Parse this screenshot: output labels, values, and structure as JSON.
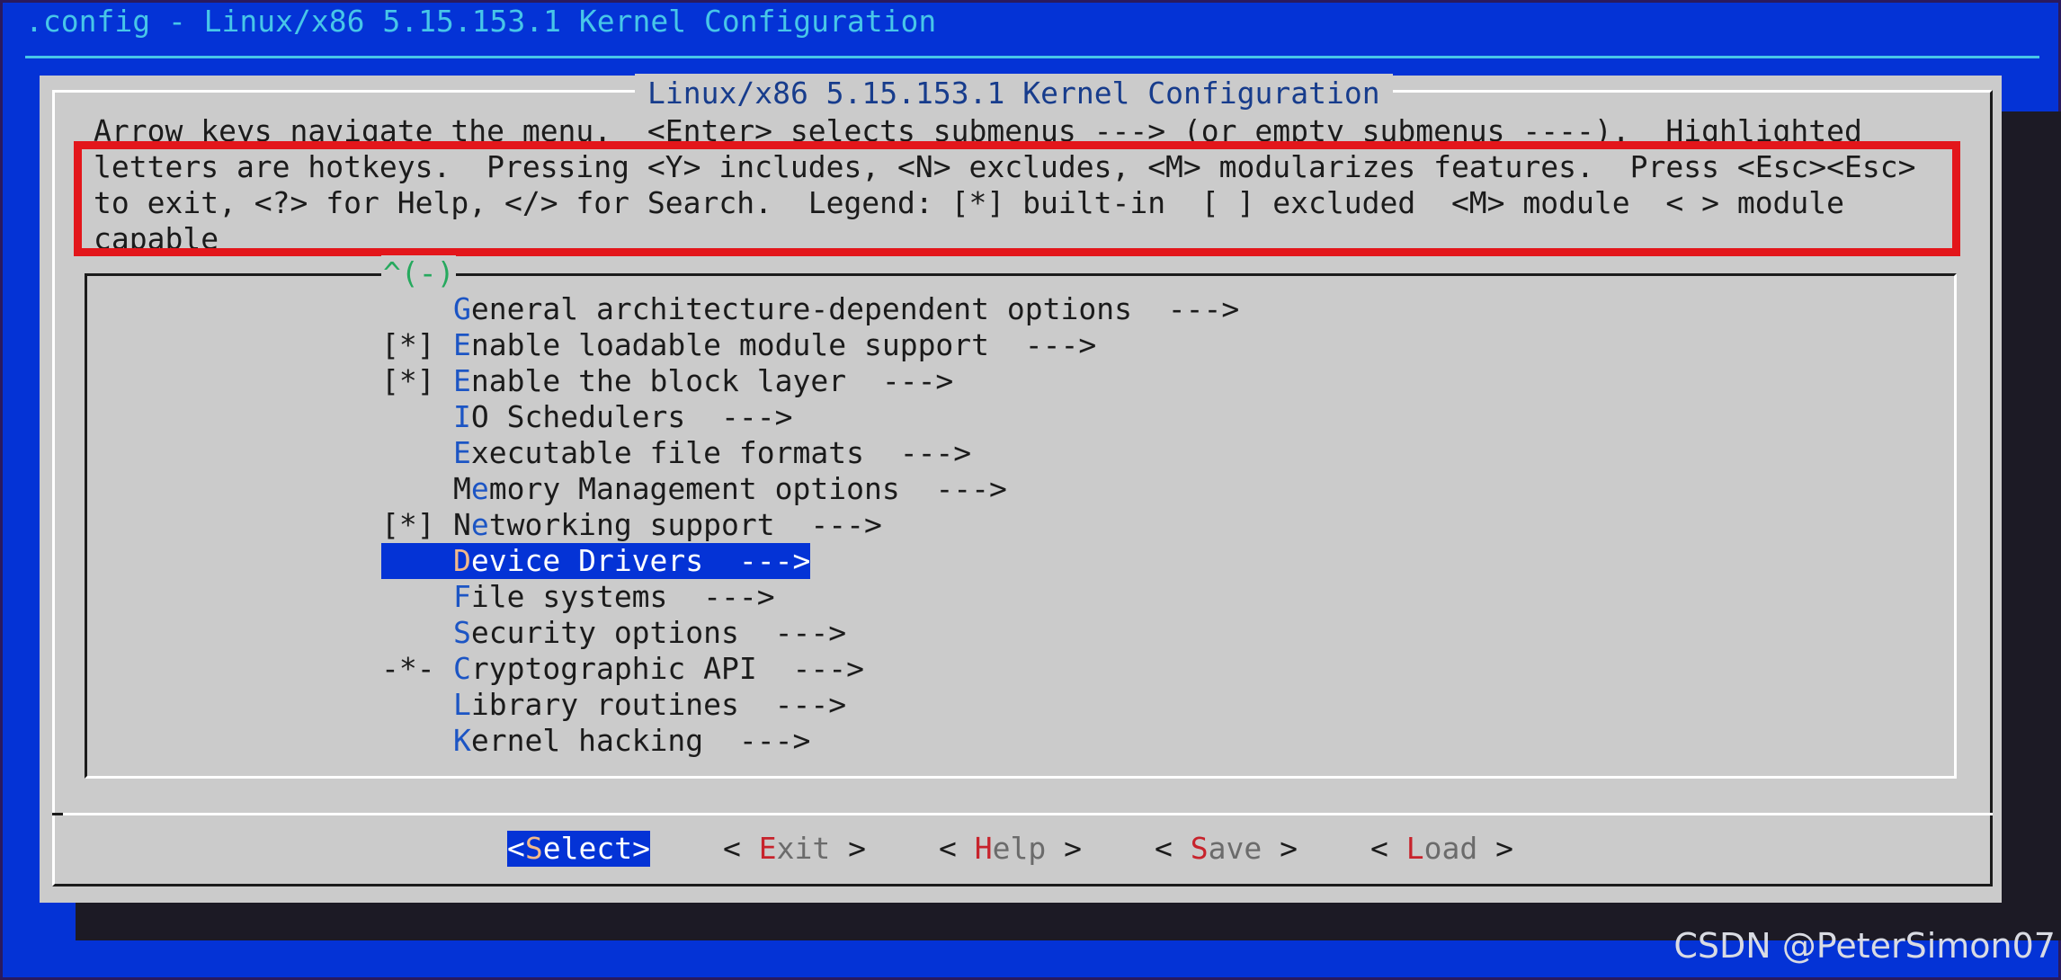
{
  "window": {
    "title": ".config - Linux/x86 5.15.153.1 Kernel Configuration"
  },
  "dialog": {
    "title": "Linux/x86 5.15.153.1 Kernel Configuration",
    "help_lines": [
      "Arrow keys navigate the menu.  <Enter> selects submenus ---> (or empty submenus ----).  Highlighted",
      "letters are hotkeys.  Pressing <Y> includes, <N> excludes, <M> modularizes features.  Press <Esc><Esc>",
      "to exit, <?> for Help, </> for Search.  Legend: [*] built-in  [ ] excluded  <M> module  < > module",
      "capable"
    ]
  },
  "menu": {
    "scroll_indicator": "^(-)",
    "selected_index": 7,
    "items": [
      {
        "prefix": "",
        "hotkey": "G",
        "before": "",
        "after": "eneral architecture-dependent options  --->"
      },
      {
        "prefix": "[*]",
        "hotkey": "E",
        "before": "",
        "after": "nable loadable module support  --->"
      },
      {
        "prefix": "[*]",
        "hotkey": "E",
        "before": "",
        "after": "nable the block layer  --->"
      },
      {
        "prefix": "",
        "hotkey": "I",
        "before": "",
        "after": "O Schedulers  --->"
      },
      {
        "prefix": "",
        "hotkey": "E",
        "before": "",
        "after": "xecutable file formats  --->"
      },
      {
        "prefix": "",
        "hotkey": "e",
        "before": "M",
        "after": "mory Management options  --->"
      },
      {
        "prefix": "[*]",
        "hotkey": "e",
        "before": "N",
        "after": "tworking support  --->"
      },
      {
        "prefix": "",
        "hotkey": "D",
        "before": "",
        "after": "evice Drivers  --->"
      },
      {
        "prefix": "",
        "hotkey": "F",
        "before": "",
        "after": "ile systems  --->"
      },
      {
        "prefix": "",
        "hotkey": "S",
        "before": "",
        "after": "ecurity options  --->"
      },
      {
        "prefix": "-*-",
        "hotkey": "C",
        "before": "",
        "after": "ryptographic API  --->"
      },
      {
        "prefix": "",
        "hotkey": "L",
        "before": "",
        "after": "ibrary routines  --->"
      },
      {
        "prefix": "",
        "hotkey": "K",
        "before": "",
        "after": "ernel hacking  --->"
      }
    ]
  },
  "buttons": [
    {
      "open": "<",
      "hotkey": "S",
      "rest": "elect",
      "close": ">",
      "selected": true
    },
    {
      "open": "< ",
      "hotkey": "E",
      "rest": "xit",
      "close": " >",
      "selected": false
    },
    {
      "open": "< ",
      "hotkey": "H",
      "rest": "elp",
      "close": " >",
      "selected": false
    },
    {
      "open": "< ",
      "hotkey": "S",
      "rest": "ave",
      "close": " >",
      "selected": false
    },
    {
      "open": "< ",
      "hotkey": "L",
      "rest": "oad",
      "close": " >",
      "selected": false
    }
  ],
  "annotation": {
    "color": "#e3161b"
  },
  "watermark": "CSDN @PeterSimon07",
  "colors": {
    "screen_background": "#0433d6",
    "dialog_background": "#cbcbcb",
    "title_text": "#173c8c",
    "menu_hotkey": "#1c55c4",
    "button_hotkey": "#c7232c",
    "selection_background": "#0433d6",
    "scroll_indicator": "#26a95e",
    "topbar_text": "#47c6e8"
  }
}
